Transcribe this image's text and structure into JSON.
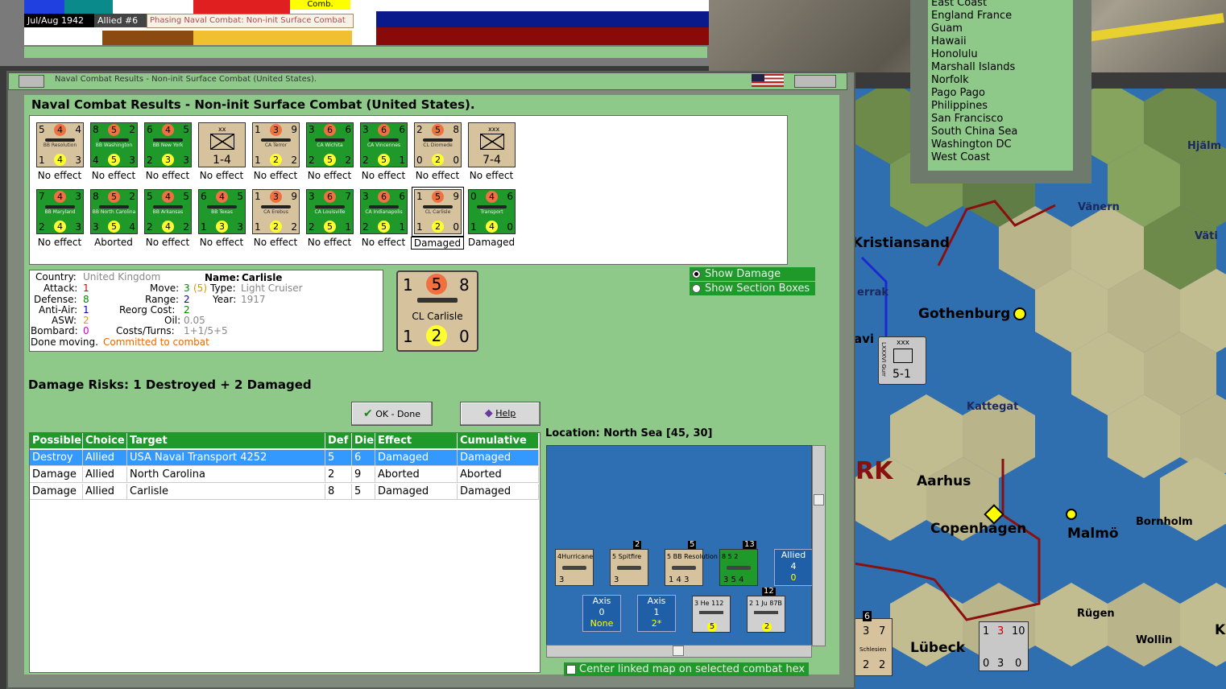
{
  "top_bar": {
    "comb_label": "Comb.",
    "date": "Jul/Aug 1942",
    "allied": "Allied #6",
    "phase": "Phasing Naval Combat: Non-init Surface Combat"
  },
  "city_list": [
    "East Coast",
    "England France",
    "Guam",
    "Hawaii",
    "Honolulu",
    "Marshall Islands",
    "Norfolk",
    "Pago Pago",
    "Philippines",
    "San Francisco",
    "South China Sea",
    "Washington DC",
    "West Coast"
  ],
  "dialog": {
    "window_title": "Naval Combat Results - Non-init Surface Combat (United States).",
    "heading": "Naval Combat Results - Non-init Surface Combat (United States).",
    "units_row1": [
      {
        "tl": "5",
        "mt": "4",
        "tr": "4",
        "name": "BB Resolution",
        "bl": "1",
        "mb": "4",
        "br": "3",
        "color": "t",
        "result": "No effect"
      },
      {
        "tl": "8",
        "mt": "5",
        "tr": "2",
        "name": "BB Washington",
        "bl": "4",
        "mb": "5",
        "br": "3",
        "color": "g",
        "result": "No effect"
      },
      {
        "tl": "6",
        "mt": "4",
        "tr": "5",
        "name": "BB New York",
        "bl": "2",
        "mb": "3",
        "br": "3",
        "color": "g",
        "result": "No effect"
      },
      {
        "tl": "",
        "mt": "",
        "tr": "",
        "name": "xx",
        "bl": "",
        "mb": "",
        "br": "",
        "color": "t",
        "result": "No effect",
        "center": "1-4",
        "army": true
      },
      {
        "tl": "1",
        "mt": "3",
        "tr": "9",
        "name": "CA Terror",
        "bl": "1",
        "mb": "2",
        "br": "2",
        "color": "t",
        "result": "No effect"
      },
      {
        "tl": "3",
        "mt": "6",
        "tr": "6",
        "name": "CA Wichita",
        "bl": "2",
        "mb": "5",
        "br": "2",
        "color": "g",
        "result": "No effect"
      },
      {
        "tl": "3",
        "mt": "6",
        "tr": "6",
        "name": "CA Vincennes",
        "bl": "2",
        "mb": "5",
        "br": "1",
        "color": "g",
        "result": "No effect"
      },
      {
        "tl": "2",
        "mt": "5",
        "tr": "8",
        "name": "CL Diomede",
        "bl": "0",
        "mb": "2",
        "br": "0",
        "color": "t",
        "result": "No effect"
      },
      {
        "tl": "",
        "mt": "",
        "tr": "",
        "name": "xxx",
        "bl": "",
        "mb": "",
        "br": "",
        "color": "t",
        "result": "No effect",
        "center": "7-4",
        "army": true
      }
    ],
    "units_row2": [
      {
        "tl": "7",
        "mt": "4",
        "tr": "3",
        "name": "BB Maryland",
        "bl": "2",
        "mb": "4",
        "br": "3",
        "color": "g",
        "result": "No effect"
      },
      {
        "tl": "8",
        "mt": "5",
        "tr": "2",
        "name": "BB North Carolina",
        "bl": "3",
        "mb": "5",
        "br": "4",
        "color": "g",
        "result": "Aborted"
      },
      {
        "tl": "5",
        "mt": "4",
        "tr": "5",
        "name": "BB Arkansas",
        "bl": "2",
        "mb": "4",
        "br": "2",
        "color": "g",
        "result": "No effect"
      },
      {
        "tl": "6",
        "mt": "4",
        "tr": "5",
        "name": "BB Texas",
        "bl": "1",
        "mb": "3",
        "br": "3",
        "color": "g",
        "result": "No effect"
      },
      {
        "tl": "1",
        "mt": "3",
        "tr": "9",
        "name": "CA Erebus",
        "bl": "1",
        "mb": "2",
        "br": "2",
        "color": "t",
        "result": "No effect"
      },
      {
        "tl": "3",
        "mt": "6",
        "tr": "7",
        "name": "CA Louisville",
        "bl": "2",
        "mb": "5",
        "br": "1",
        "color": "g",
        "result": "No effect"
      },
      {
        "tl": "3",
        "mt": "6",
        "tr": "6",
        "name": "CA Indianapolis",
        "bl": "2",
        "mb": "5",
        "br": "1",
        "color": "g",
        "result": "No effect"
      },
      {
        "tl": "1",
        "mt": "5",
        "tr": "9",
        "name": "CL Carlisle",
        "bl": "1",
        "mb": "2",
        "br": "0",
        "color": "t",
        "result": "Damaged",
        "selected": true
      },
      {
        "tl": "0",
        "mt": "4",
        "tr": "6",
        "name": "Transport",
        "bl": "1",
        "mb": "4",
        "br": "0",
        "color": "g",
        "result": "Damaged"
      }
    ],
    "info": {
      "country_label": "Country:",
      "country": "United Kingdom",
      "attack_label": "Attack:",
      "attack": "1",
      "defense_label": "Defense:",
      "defense": "8",
      "antiair_label": "Anti-Air:",
      "antiair": "1",
      "asw_label": "ASW:",
      "asw": "2",
      "bombard_label": "Bombard:",
      "bombard": "0",
      "done_label": "Done moving.",
      "done": "Committed to combat",
      "name_label": "Name:",
      "name": "Carlisle",
      "move_label": "Move:",
      "move": "3",
      "move2": "(5)",
      "type_label": "Type:",
      "type": "Light Cruiser",
      "range_label": "Range:",
      "range": "2",
      "year_label": "Year:",
      "year": "1917",
      "reorg_label": "Reorg Cost:",
      "reorg": "2",
      "oil_label": "Oil:",
      "oil": "0.05",
      "costs_label": "Costs/Turns:",
      "costs": "1+1/5+5"
    },
    "big_counter": {
      "tl": "1",
      "mt": "5",
      "tr": "8",
      "name": "CL Carlisle",
      "bl": "1",
      "mb": "2",
      "br": "0"
    },
    "show_damage": "Show Damage",
    "show_section": "Show Section Boxes",
    "damage_risk": "Damage Risks:  1 Destroyed + 2 Damaged",
    "ok_label": "OK - Done",
    "help_label": "Help",
    "table": {
      "headers": [
        "Possible",
        "Choice",
        "Target",
        "Def",
        "Die",
        "Effect",
        "Cumulative"
      ],
      "rows": [
        [
          "Destroy",
          "Allied",
          "USA Naval Transport 4252",
          "5",
          "6",
          "Damaged",
          "Damaged"
        ],
        [
          "Damage",
          "Allied",
          "North Carolina",
          "2",
          "9",
          "Aborted",
          "Aborted"
        ],
        [
          "Damage",
          "Allied",
          "Carlisle",
          "8",
          "5",
          "Damaged",
          "Damaged"
        ]
      ]
    },
    "location": "Location:  North Sea [45, 30]",
    "sea_units": [
      {
        "badge": "",
        "label": "4Hurricane",
        "bottom": "3",
        "color": "t"
      },
      {
        "badge": "2",
        "label": "5 Spitfire",
        "bottom": "3",
        "color": "t"
      },
      {
        "badge": "5",
        "label": "5 BB Resolution 4",
        "bottom": "1 4 3",
        "color": "t"
      },
      {
        "badge": "13",
        "label": "8 5 2",
        "bottom": "3 5 4",
        "color": "g"
      }
    ],
    "allied_box": {
      "title": "Allied",
      "v1": "4",
      "v2": "0"
    },
    "axis_box1": {
      "title": "Axis",
      "v1": "0",
      "v2": "None"
    },
    "axis_box2": {
      "title": "Axis",
      "v1": "1",
      "v2": "2*"
    },
    "axis_units": [
      {
        "badge": "",
        "label": "3 He 112",
        "bottom": "5",
        "color": "w"
      },
      {
        "badge": "12",
        "label": "2 1 Ju 87B",
        "bottom": "2",
        "color": "w"
      }
    ],
    "center_map": "Center linked map on selected combat hex"
  },
  "map": {
    "labels": [
      "Kristiansand",
      "Vänern",
      "Väti",
      "Hjälm",
      "errak",
      "Gothenburg",
      "Kattegat",
      "RK",
      "Aarhus",
      "Copenhagen",
      "Malmö",
      "Bornholm",
      "Rügen",
      "Lübeck",
      "Wollin",
      "K",
      "avi"
    ],
    "army_counter": {
      "top": "xxx",
      "side": "LXXXVI Gurr",
      "value": "5-1"
    },
    "bottom_counters": [
      {
        "tl": "3",
        "tr": "7",
        "name": "Schlesien",
        "bl": "2",
        "br": "2",
        "badge": "6"
      },
      {
        "tl": "1",
        "mt": "3",
        "tr": "10",
        "bl": "0",
        "mb": "3",
        "br": "0"
      }
    ]
  }
}
